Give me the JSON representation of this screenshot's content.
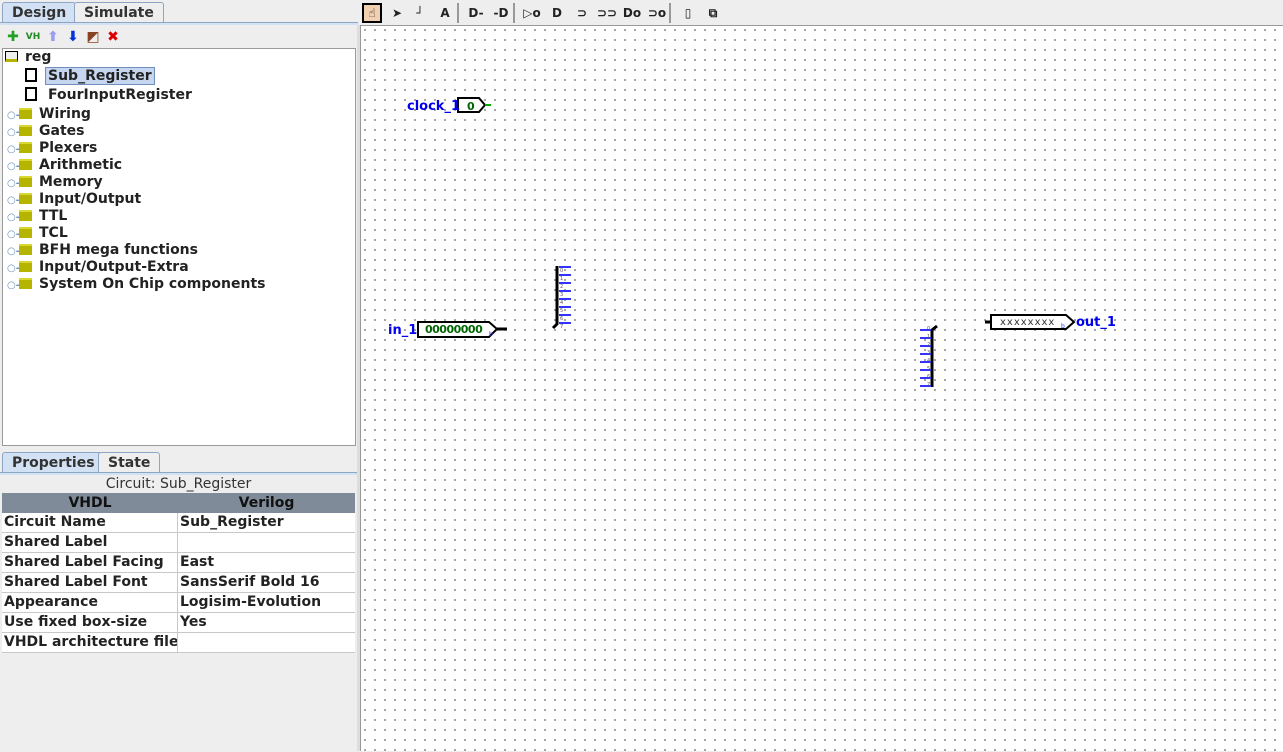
{
  "top_tabs": [
    {
      "label": "Design",
      "selected": true
    },
    {
      "label": "Simulate",
      "selected": false
    }
  ],
  "explorer_toolbar": [
    {
      "icon": "add-circuit-icon",
      "glyph": "✚",
      "color": "#22a022"
    },
    {
      "icon": "vhdl-icon",
      "glyph": "VH",
      "color": "#228822"
    },
    {
      "icon": "move-up-icon",
      "glyph": "⬆",
      "color": "#9a9aee"
    },
    {
      "icon": "move-down-icon",
      "glyph": "⬇",
      "color": "#0033dd"
    },
    {
      "icon": "edit-appearance-icon",
      "glyph": "◩",
      "color": "#884422"
    },
    {
      "icon": "delete-icon",
      "glyph": "✖",
      "color": "#dd0000"
    }
  ],
  "tree": {
    "root": "reg",
    "circuits": [
      {
        "label": "Sub_Register",
        "selected": true
      },
      {
        "label": "FourInputRegister",
        "selected": false
      }
    ],
    "libraries": [
      "Wiring",
      "Gates",
      "Plexers",
      "Arithmetic",
      "Memory",
      "Input/Output",
      "TTL",
      "TCL",
      "BFH mega functions",
      "Input/Output-Extra",
      "System On Chip components"
    ]
  },
  "tools": [
    "poke-tool-icon",
    "select-tool-icon",
    "wire-tool-icon",
    "text-tool-icon",
    "input-pin-icon",
    "output-pin-icon",
    "not-gate-icon",
    "and-gate-icon",
    "or-gate-icon",
    "xor-gate-icon",
    "nand-gate-icon",
    "nor-gate-icon",
    "add-component-icon",
    "add-subcircuit-icon"
  ],
  "text_tool_glyph": "A",
  "prop_tabs": [
    {
      "label": "Properties",
      "selected": true
    },
    {
      "label": "State",
      "selected": false
    }
  ],
  "properties": {
    "title": "Circuit: Sub_Register",
    "headers": [
      "VHDL",
      "Verilog"
    ],
    "rows": [
      {
        "key": "Circuit Name",
        "value": "Sub_Register"
      },
      {
        "key": "Shared Label",
        "value": ""
      },
      {
        "key": "Shared Label Facing",
        "value": "East"
      },
      {
        "key": "Shared Label Font",
        "value": "SansSerif Bold 16"
      },
      {
        "key": "Appearance",
        "value": "Logisim-Evolution"
      },
      {
        "key": "Use fixed box-size",
        "value": "Yes"
      },
      {
        "key": "VHDL architecture file ...",
        "value": ""
      }
    ]
  },
  "canvas": {
    "clock": {
      "label": "clock_1",
      "value": "0"
    },
    "input": {
      "label": "in_1",
      "value": "00000000",
      "radix": "b"
    },
    "output": {
      "label": "out_1",
      "value": "xxxxxxxx",
      "radix": "b"
    },
    "splitter_bits": [
      "0",
      "1",
      "2",
      "3",
      "4",
      "5",
      "6",
      "7"
    ]
  },
  "colors": {
    "wire_bus": "#000000",
    "wire_bit": "#3333ff",
    "label": "#0000ee",
    "value": "#006400"
  }
}
